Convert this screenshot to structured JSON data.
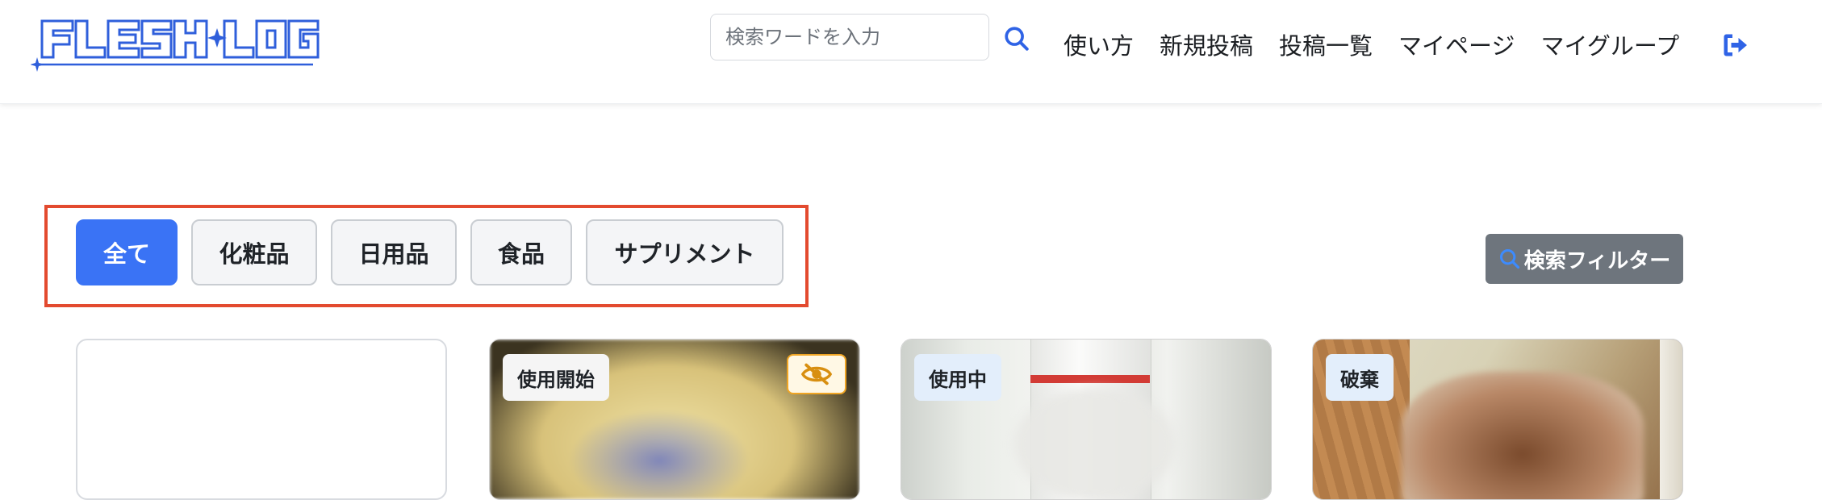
{
  "app": {
    "logo_text": "FLESH LOG"
  },
  "header": {
    "search_placeholder": "検索ワードを入力",
    "search_icon": "magnifier-icon",
    "nav": [
      {
        "label": "使い方"
      },
      {
        "label": "新規投稿"
      },
      {
        "label": "投稿一覧"
      },
      {
        "label": "マイページ"
      },
      {
        "label": "マイグループ"
      }
    ],
    "logout_icon": "logout-icon"
  },
  "categories": {
    "tabs": [
      {
        "label": "全て",
        "active": true
      },
      {
        "label": "化粧品",
        "active": false
      },
      {
        "label": "日用品",
        "active": false
      },
      {
        "label": "食品",
        "active": false
      },
      {
        "label": "サプリメント",
        "active": false
      }
    ],
    "highlight_color": "#e34a2f"
  },
  "filter": {
    "label": "検索フィルター",
    "icon": "search-icon"
  },
  "cards": [
    {
      "status": ""
    },
    {
      "status": "使用開始",
      "hidden_icon": "eye-slash-icon"
    },
    {
      "status": "使用中"
    },
    {
      "status": "破棄"
    }
  ],
  "colors": {
    "accent": "#3a73f5",
    "filter_button": "#6e757d",
    "hidden_toggle": "#f0a524"
  }
}
